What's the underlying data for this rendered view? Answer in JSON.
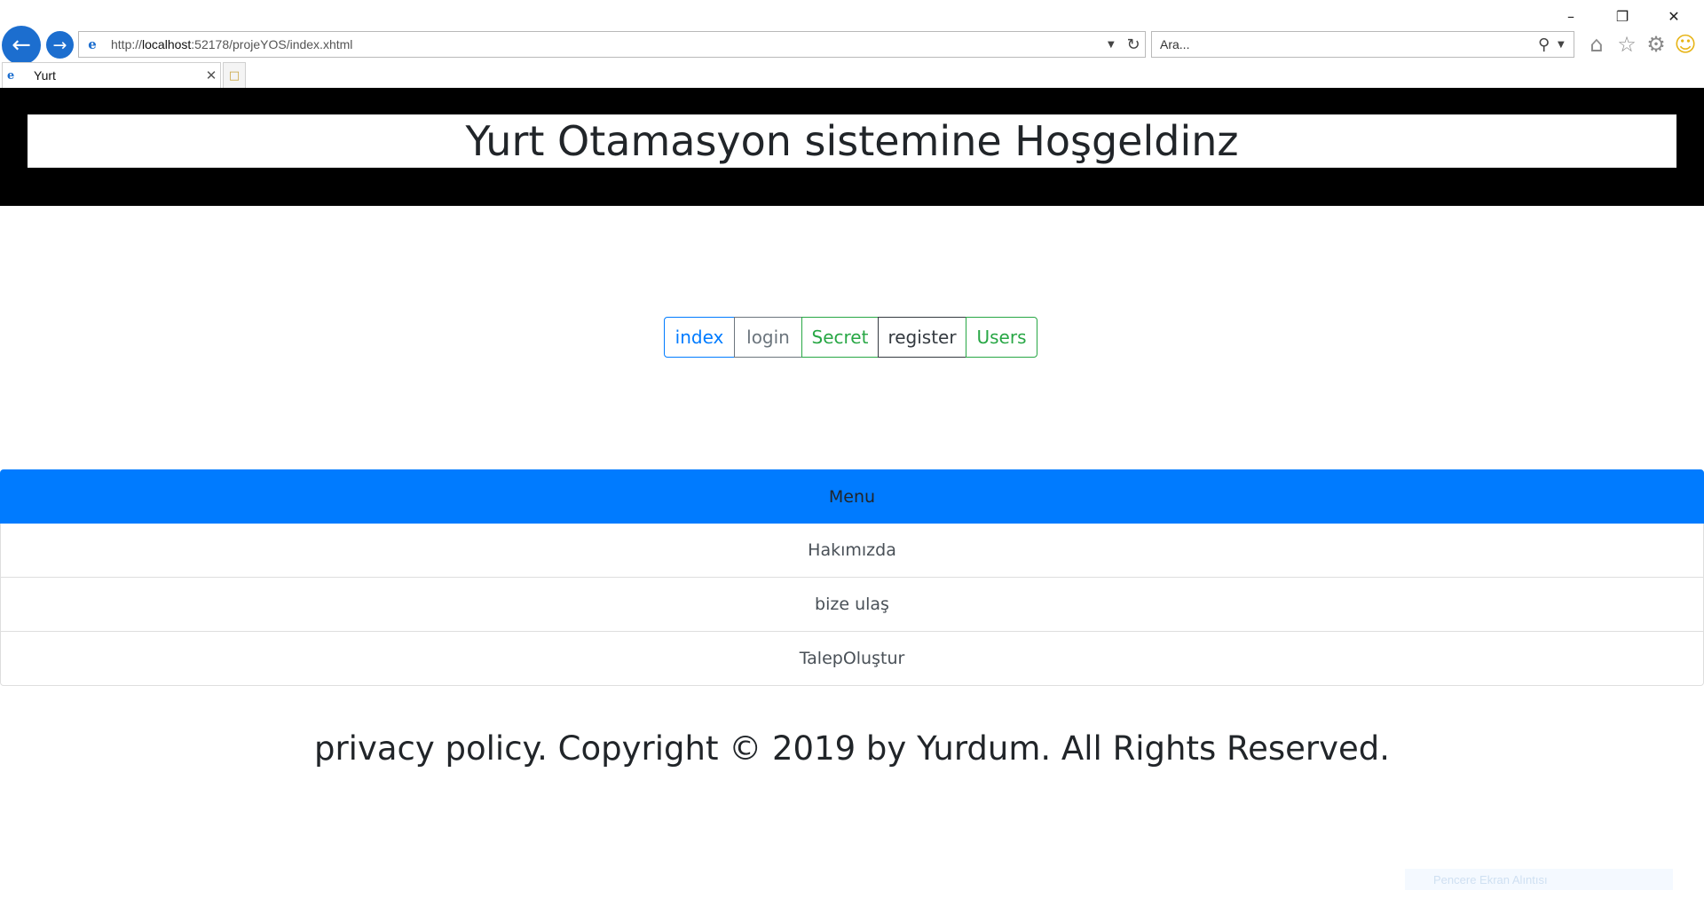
{
  "browser": {
    "address": {
      "prefix": "http://",
      "host": "localhost",
      "rest": ":52178/projeYOS/index.xhtml"
    },
    "search_placeholder": "Ara...",
    "tab_title": "Yurt",
    "icons": [
      "back-icon",
      "forward-icon",
      "refresh-icon",
      "search-icon",
      "home-icon",
      "favorites-star-icon",
      "settings-gear-icon",
      "smiley-feedback-icon"
    ]
  },
  "header": {
    "title": "Yurt Otamasyon sistemine Hoşgeldinz"
  },
  "nav_buttons": [
    {
      "label": "index",
      "color": "#007bff"
    },
    {
      "label": "login",
      "color": "#6c757d"
    },
    {
      "label": "Secret",
      "color": "#28a745"
    },
    {
      "label": "register",
      "color": "#343a40"
    },
    {
      "label": "Users",
      "color": "#28a745"
    }
  ],
  "menu": {
    "heading": "Menu",
    "items": [
      "Hakımızda",
      "bize ulaş",
      "TalepOluştur"
    ],
    "accent": "#007bff"
  },
  "footer": {
    "text": "privacy policy. Copyright © 2019 by Yurdum. All Rights Reserved."
  },
  "overlay": {
    "snip_label": "Pencere Ekran Alıntısı"
  }
}
